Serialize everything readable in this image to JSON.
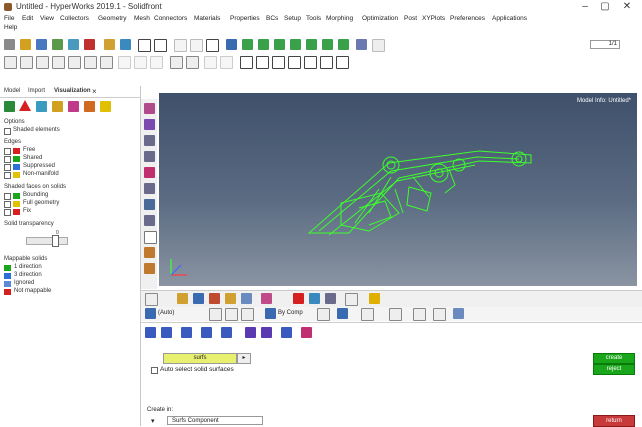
{
  "window": {
    "title": "Untitled - HyperWorks 2019.1 - Solidfront",
    "minimize": "–",
    "maximize": "▢",
    "close": "✕"
  },
  "menu": [
    "File",
    "Edit",
    "View",
    "Collectors",
    "Geometry",
    "Mesh",
    "Connectors",
    "Materials",
    "Properties",
    "BCs",
    "Setup",
    "Tools",
    "Morphing",
    "Optimization",
    "Post",
    "XYPlots",
    "Preferences",
    "Applications",
    "Help"
  ],
  "toolbar": {
    "page_field": "1/1"
  },
  "left_panel": {
    "tabs": [
      "Model",
      "Import",
      "Visualization"
    ],
    "close": "×",
    "options_label": "Options",
    "shaded_elements": "Shaded elements",
    "edges_label": "Edges",
    "edges": [
      {
        "label": "Free",
        "color": "#d62020"
      },
      {
        "label": "Shared",
        "color": "#1aa61a"
      },
      {
        "label": "Suppressed",
        "color": "#2f6fd8"
      },
      {
        "label": "Non-manifold",
        "color": "#e0c200"
      }
    ],
    "shaded_faces_label": "Shaded faces on solids",
    "shaded_faces": [
      {
        "label": "Bounding",
        "color": "#1aa61a"
      },
      {
        "label": "Full geometry",
        "color": "#e0c200"
      },
      {
        "label": "Fix",
        "color": "#d62020"
      }
    ],
    "transparency_label": "Solid transparency",
    "slider_value": "0",
    "mappable_label": "Mappable solids",
    "mappable": [
      {
        "label": "1 direction",
        "color": "#1aa61a"
      },
      {
        "label": "3 direction",
        "color": "#2f6fd8"
      },
      {
        "label": "Ignored",
        "color": "#5a8ad8"
      },
      {
        "label": "Not mappable",
        "color": "#d62020"
      }
    ]
  },
  "viewport": {
    "model_info": "Model Info: Untitled*",
    "model_color": "#3cff2a",
    "axis_color": "#ffffff",
    "axis_x": "#ff3b3b",
    "axis_y": "#3cff3c",
    "axis_z": "#3b6bff"
  },
  "bottom": {
    "view_combo": "(Auto)",
    "bycomp_combo": "By Comp"
  },
  "panel": {
    "selector": "surfs",
    "auto_select": "Auto select solid surfaces",
    "create_in_label": "Create in:",
    "component_field": "Surfs Component",
    "create_button": "create",
    "reject_button": "reject",
    "return_button": "return"
  }
}
